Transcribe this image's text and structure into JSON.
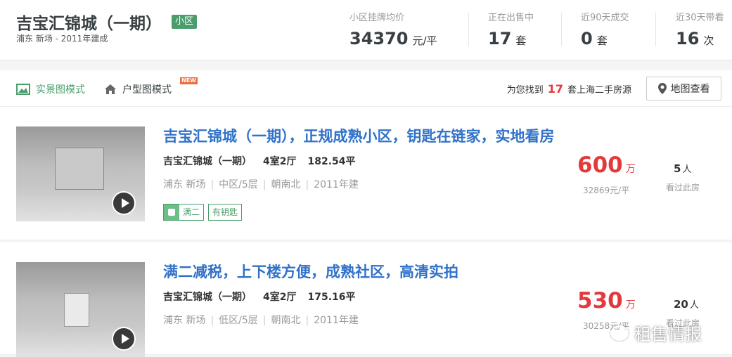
{
  "header": {
    "title": "吉宝汇锦城（一期）",
    "badge": "小区",
    "subtitle": "浦东 新场 - 2011年建成",
    "stats": [
      {
        "label": "小区挂牌均价",
        "value": "34370",
        "unit": "元/平"
      },
      {
        "label": "正在出售中",
        "value": "17",
        "unit": "套"
      },
      {
        "label": "近90天成交",
        "value": "0",
        "unit": "套"
      },
      {
        "label": "近30天带看",
        "value": "16",
        "unit": "次"
      }
    ]
  },
  "toolbar": {
    "photo_mode": "实景图模式",
    "layout_mode": "户型图模式",
    "new_badge": "NEW",
    "found_prefix": "为您找到",
    "found_count": "17",
    "found_suffix": "套上海二手房源",
    "map_button": "地图查看"
  },
  "listings": [
    {
      "title": "吉宝汇锦城（一期），正规成熟小区，钥匙在链家，实地看房",
      "community": "吉宝汇锦城（一期）",
      "layout": "4室2厅",
      "area": "182.54平",
      "district": "浦东 新场",
      "floor": "中区/5层",
      "orientation": "朝南北",
      "built": "2011年建",
      "tags": [
        "满二",
        "有钥匙"
      ],
      "price": "600",
      "price_unit": "万",
      "unit_price": "32869元/平",
      "viewers": "5",
      "viewers_unit": "人",
      "viewers_label": "看过此房"
    },
    {
      "title": "满二减税，上下楼方便，成熟社区，高清实拍",
      "community": "吉宝汇锦城（一期）",
      "layout": "4室2厅",
      "area": "175.16平",
      "district": "浦东 新场",
      "floor": "低区/5层",
      "orientation": "朝南北",
      "built": "2011年建",
      "price": "530",
      "price_unit": "万",
      "unit_price": "30258元/平",
      "viewers": "20",
      "viewers_unit": "人",
      "viewers_label": "看过此房"
    }
  ],
  "watermark": "租售情报",
  "colors": {
    "accent_green": "#4a9e6c",
    "link_blue": "#3072c9",
    "price_red": "#e4393c"
  }
}
